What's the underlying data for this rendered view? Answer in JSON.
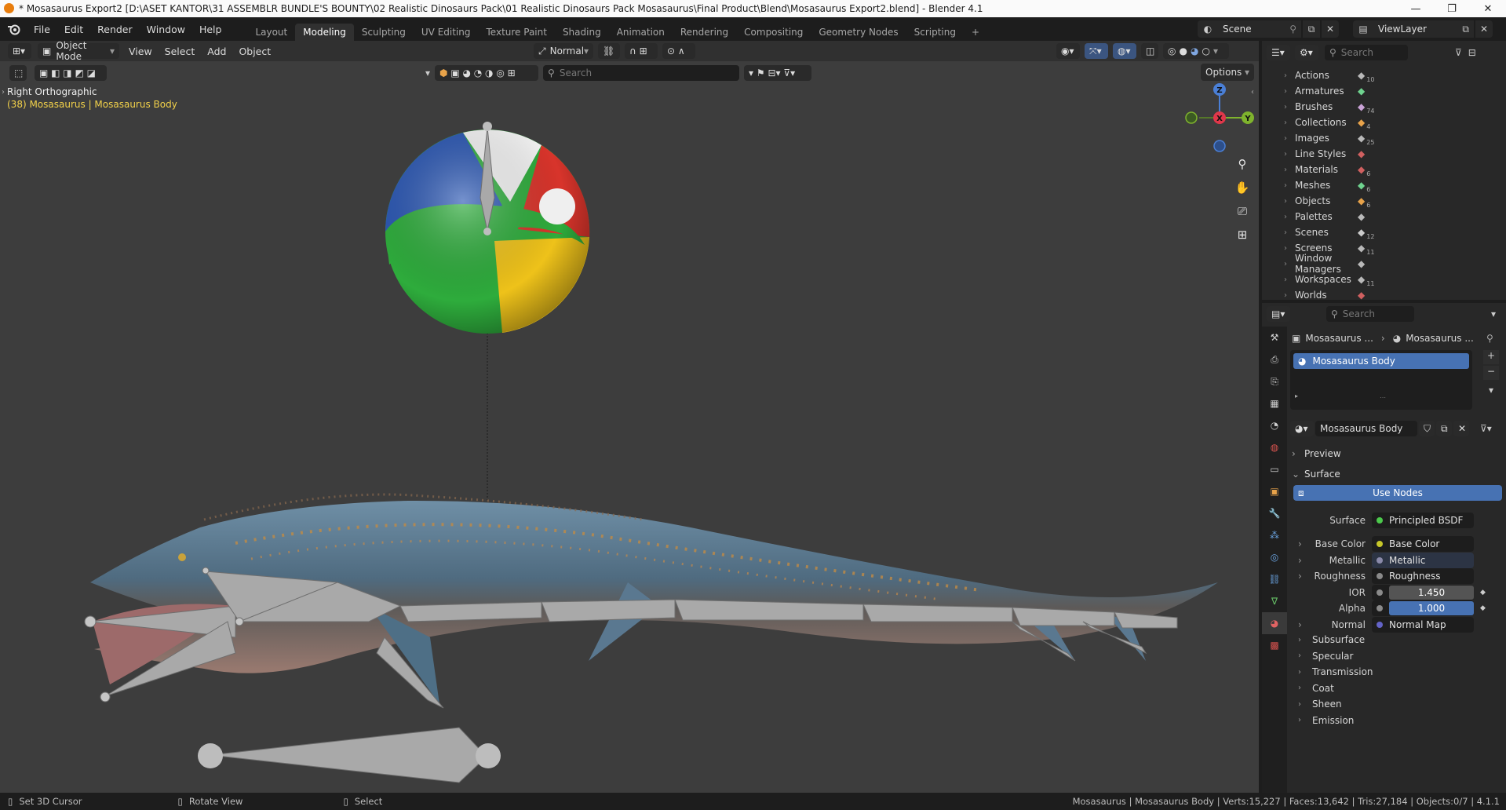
{
  "window": {
    "title": "* Mosasaurus Export2 [D:\\ASET KANTOR\\31 ASSEMBLR BUNDLE'S BOUNTY\\02 Realistic Dinosaurs Pack\\01 Realistic Dinosaurs Pack Mosasaurus\\Final Product\\Blend\\Mosasaurus Export2.blend] - Blender 4.1",
    "minimize": "—",
    "maximize": "❐",
    "close": "✕"
  },
  "menu": [
    "File",
    "Edit",
    "Render",
    "Window",
    "Help"
  ],
  "workspaces": [
    "Layout",
    "Modeling",
    "Sculpting",
    "UV Editing",
    "Texture Paint",
    "Shading",
    "Animation",
    "Rendering",
    "Compositing",
    "Geometry Nodes",
    "Scripting"
  ],
  "active_workspace": "Modeling",
  "scene_name": "Scene",
  "view_layer": "ViewLayer",
  "viewport": {
    "mode": "Object Mode",
    "menus": [
      "View",
      "Select",
      "Add",
      "Object"
    ],
    "orientation": "Normal",
    "search_placeholder": "Search",
    "options_label": "Options",
    "view_name": "Right Orthographic",
    "object_info": "(38) Mosasaurus | Mosasaurus Body",
    "axis_labels": {
      "z": "Z",
      "y": "Y",
      "x": "X"
    }
  },
  "outliner": {
    "search_placeholder": "Search",
    "items": [
      {
        "label": "Actions",
        "count": "10"
      },
      {
        "label": "Armatures",
        "count": ""
      },
      {
        "label": "Brushes",
        "count": "74"
      },
      {
        "label": "Collections",
        "count": "4"
      },
      {
        "label": "Images",
        "count": "25"
      },
      {
        "label": "Line Styles",
        "count": ""
      },
      {
        "label": "Materials",
        "count": "6"
      },
      {
        "label": "Meshes",
        "count": "6"
      },
      {
        "label": "Objects",
        "count": "6"
      },
      {
        "label": "Palettes",
        "count": ""
      },
      {
        "label": "Scenes",
        "count": "12"
      },
      {
        "label": "Screens",
        "count": "11"
      },
      {
        "label": "Window Managers",
        "count": ""
      },
      {
        "label": "Workspaces",
        "count": "11"
      },
      {
        "label": "Worlds",
        "count": ""
      }
    ]
  },
  "properties": {
    "search_placeholder": "Search",
    "breadcrumb": [
      "Mosasaurus ...",
      "Mosasaurus ..."
    ],
    "material_slot": "Mosasaurus Body",
    "material_name": "Mosasaurus Body",
    "panels": {
      "preview": "Preview",
      "surface": "Surface"
    },
    "use_nodes": "Use Nodes",
    "surface_label": "Surface",
    "surface_shader": "Principled BSDF",
    "inputs": [
      {
        "label": "Base Color",
        "value": "Base Color",
        "dot": "#c7c729",
        "chev": true
      },
      {
        "label": "Metallic",
        "value": "Metallic",
        "dot": "#8a8aaa",
        "chev": true
      },
      {
        "label": "Roughness",
        "value": "Roughness",
        "dot": "#8a8a8a",
        "chev": true
      },
      {
        "label": "IOR",
        "value": "1.450",
        "dot": "#8a8a8a",
        "chev": false
      },
      {
        "label": "Alpha",
        "value": "1.000",
        "dot": "#8a8a8a",
        "chev": false
      },
      {
        "label": "Normal",
        "value": "Normal Map",
        "dot": "#6363c7",
        "chev": true
      }
    ],
    "subpanels": [
      "Subsurface",
      "Specular",
      "Transmission",
      "Coat",
      "Sheen",
      "Emission"
    ],
    "colors": {
      "accent": "#4772b3",
      "panel_bg": "#282828"
    }
  },
  "status": {
    "hint_left": "Set 3D Cursor",
    "hint_mid": "Rotate View",
    "hint_right": "Select",
    "info": "Mosasaurus | Mosasaurus Body | Verts:15,227 | Faces:13,642 | Tris:27,184 | Objects:0/7 | 4.1.1"
  }
}
